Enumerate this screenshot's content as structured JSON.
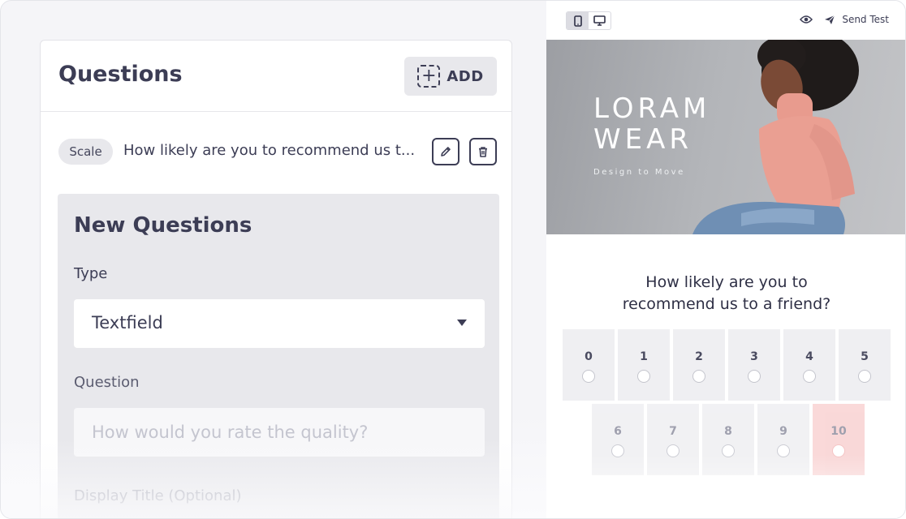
{
  "questions_panel": {
    "title": "Questions",
    "add_label": "ADD",
    "item": {
      "type_badge": "Scale",
      "text": "How likely are you to recommend us t..."
    }
  },
  "new_question": {
    "title": "New Questions",
    "type_label": "Type",
    "type_value": "Textfield",
    "question_label": "Question",
    "question_placeholder": "How would you rate the quality?",
    "display_title_label": "Display Title (Optional)"
  },
  "preview": {
    "send_test_label": "Send Test",
    "brand_line1": "LORAM",
    "brand_line2": "WEAR",
    "tagline": "Design to Move",
    "question_line1": "How likely are you to",
    "question_line2": "recommend us to a friend?",
    "scale": [
      "0",
      "1",
      "2",
      "3",
      "4",
      "5",
      "6",
      "7",
      "8",
      "9",
      "10"
    ],
    "selected_value": "10",
    "colors": {
      "selected_cell": "#f9d2d2",
      "cell": "#efeff2",
      "text_primary": "#3c3d55"
    }
  }
}
